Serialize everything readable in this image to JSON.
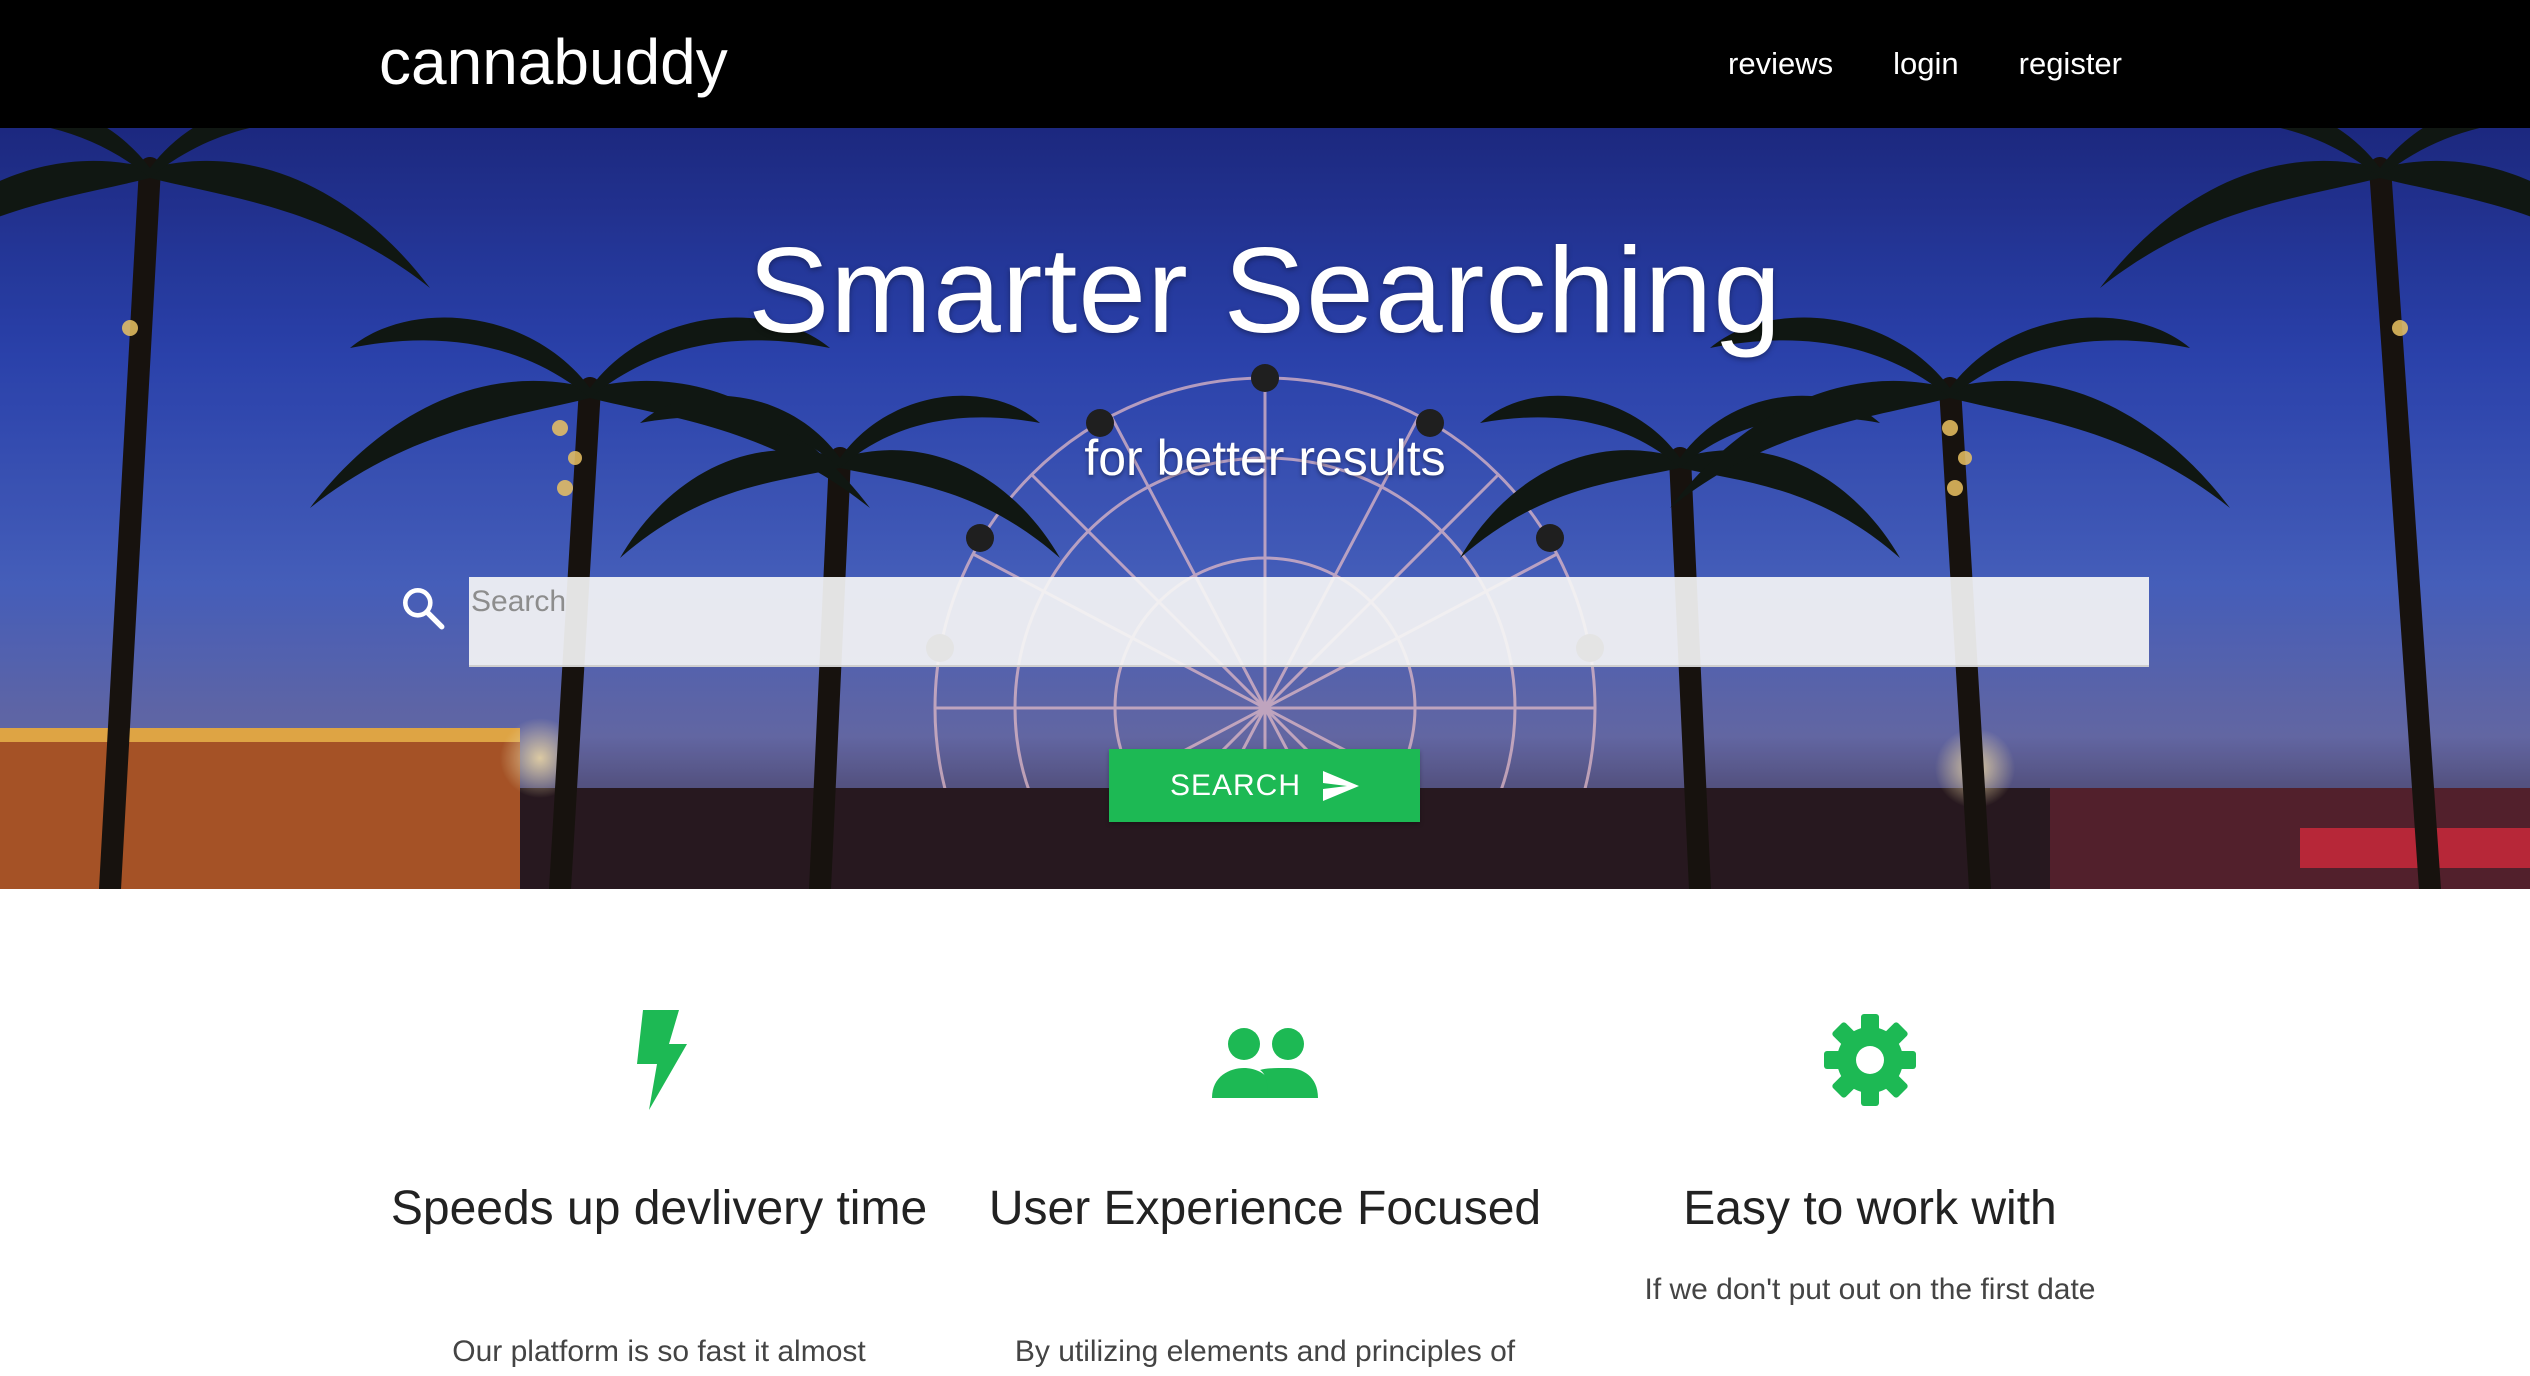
{
  "navbar": {
    "brand": "cannabuddy",
    "links": [
      "reviews",
      "login",
      "register"
    ]
  },
  "hero": {
    "title": "Smarter Searching",
    "subtitle": "for better results",
    "search_placeholder": "Search",
    "search_button_label": "SEARCH"
  },
  "features": [
    {
      "icon": "bolt-icon",
      "title": "Speeds up devlivery time",
      "text_visible": "Our platform is so fast it almost"
    },
    {
      "icon": "people-icon",
      "title": "User Experience Focused",
      "text_visible": "By utilizing elements and principles of"
    },
    {
      "icon": "gear-icon",
      "title": "Easy to work with",
      "text_visible": "If we don't put out on the first date"
    }
  ],
  "colors": {
    "accent": "#1db954",
    "navbar": "#000000"
  }
}
